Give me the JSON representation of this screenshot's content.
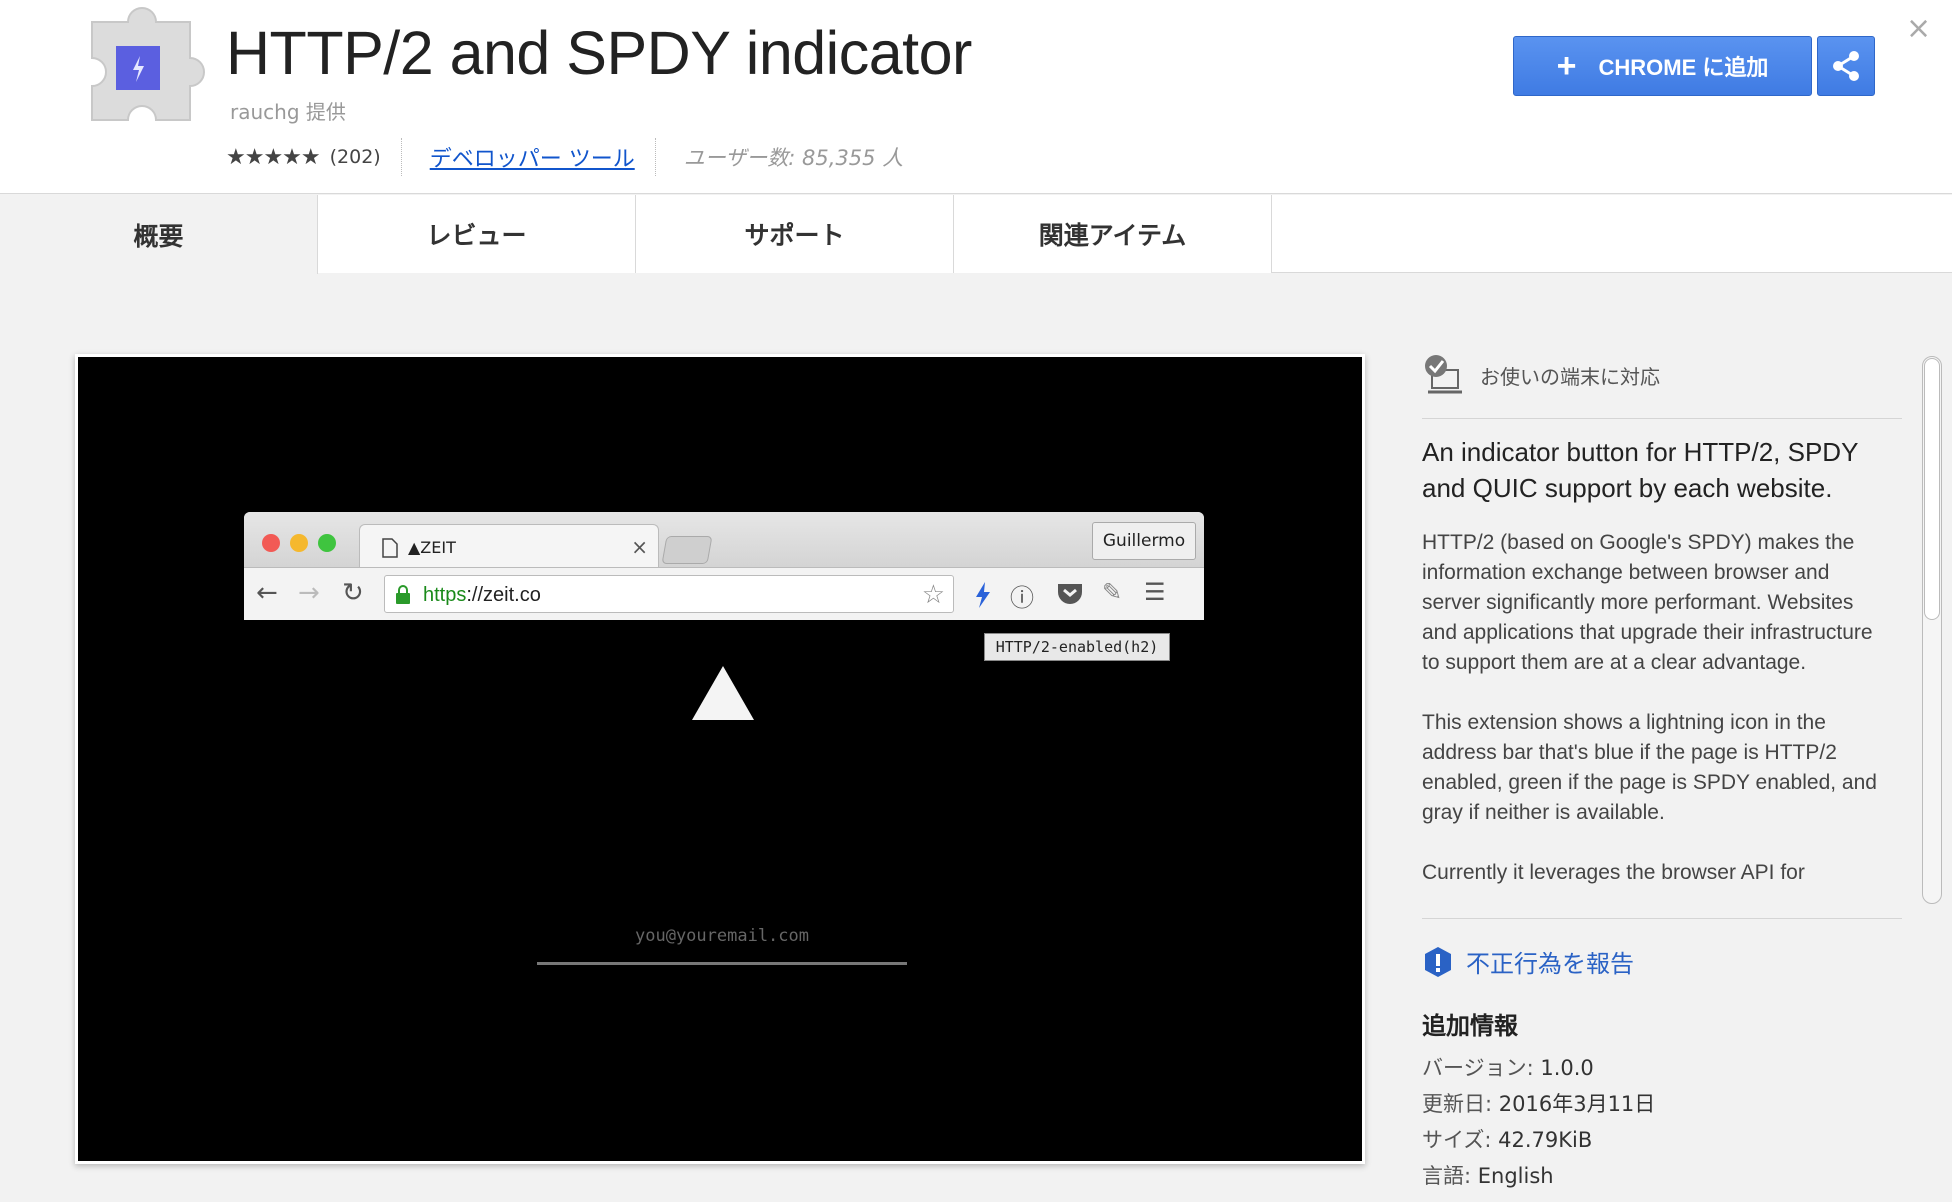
{
  "header": {
    "title": "HTTP/2 and SPDY indicator",
    "provider": "rauchg 提供",
    "stars": "★★★★★",
    "rating_count": "(202)",
    "category": "デベロッパー ツール",
    "users": "ユーザー数: 85,355 人",
    "add_button": "CHROME に追加",
    "accent_color": "#4a86e8"
  },
  "tabs": [
    {
      "label": "概要"
    },
    {
      "label": "レビュー"
    },
    {
      "label": "サポート"
    },
    {
      "label": "関連アイテム"
    }
  ],
  "screenshot": {
    "tab_title": "▲ZEIT",
    "profile": "Guillermo",
    "url_scheme": "https",
    "url_rest": "://zeit.co",
    "tooltip": "HTTP/2-enabled(h2)",
    "email_placeholder": "you@youremail.com"
  },
  "sidebar": {
    "compat": "お使いの端末に対応",
    "summary": "An indicator button for HTTP/2, SPDY and QUIC support by each website.",
    "desc": [
      "HTTP/2 (based on Google's SPDY) makes the information exchange between browser and server significantly more performant. Websites and applications that upgrade their infrastructure to support them are at a clear advantage.",
      "This extension shows a lightning icon in the address bar that's blue if the page is HTTP/2 enabled, green if the page is SPDY enabled, and gray if neither is available.",
      "Currently it leverages the browser API for"
    ],
    "report": "不正行為を報告",
    "additional_title": "追加情報",
    "info": [
      {
        "label": "バージョン: ",
        "value": "1.0.0"
      },
      {
        "label": "更新日: ",
        "value": "2016年3月11日"
      },
      {
        "label": "サイズ: ",
        "value": "42.79KiB"
      },
      {
        "label": "言語: ",
        "value": "English"
      }
    ]
  }
}
